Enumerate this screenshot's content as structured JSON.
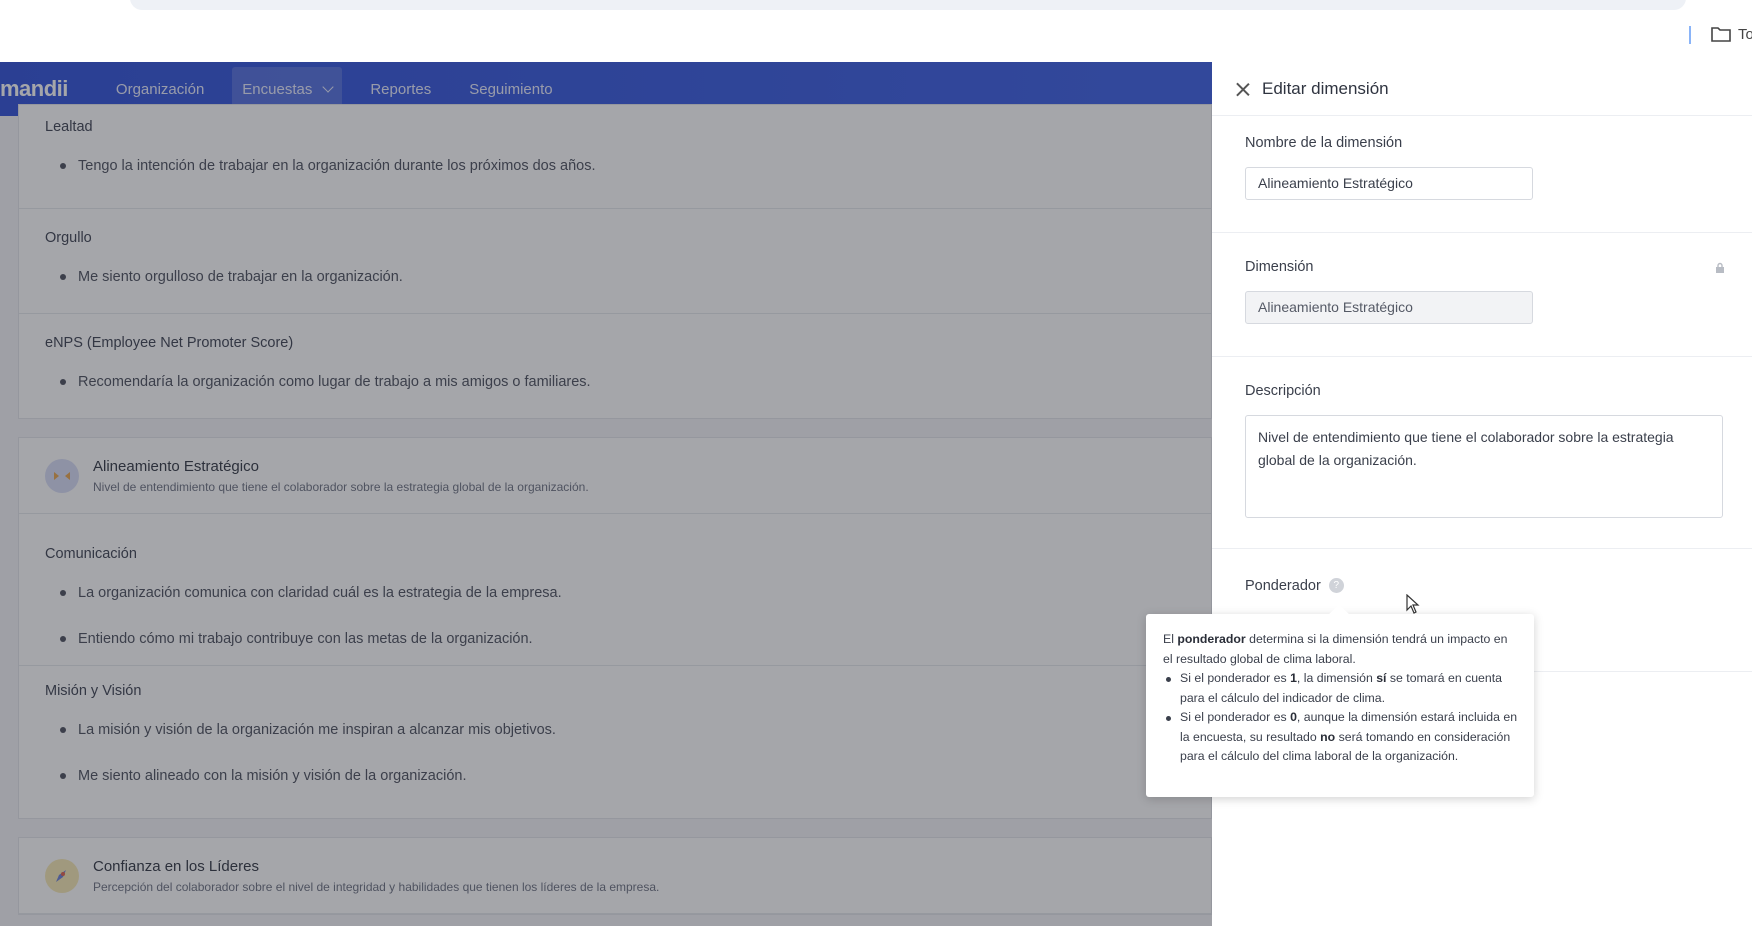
{
  "browser": {
    "bookmark_label": "To"
  },
  "header": {
    "logo": "mandii",
    "nav": [
      {
        "label": "Organización"
      },
      {
        "label": "Encuestas"
      },
      {
        "label": "Reportes"
      },
      {
        "label": "Seguimiento"
      }
    ]
  },
  "groups": [
    {
      "sections": [
        {
          "title": "Lealtad",
          "questions": [
            "Tengo la intención de trabajar en la organización durante los próximos dos años."
          ]
        },
        {
          "title": "Orgullo",
          "questions": [
            "Me siento orgulloso de trabajar en la organización."
          ]
        },
        {
          "title": "eNPS (Employee Net Promoter Score)",
          "questions": [
            "Recomendaría la organización como lugar de trabajo a mis amigos o familiares."
          ]
        }
      ]
    },
    {
      "dimension": {
        "name": "Alineamiento Estratégico",
        "description": "Nivel de entendimiento que tiene el colaborador sobre la estrategia global de la organización.",
        "icon": "target-icon"
      },
      "sections": [
        {
          "title": "Comunicación",
          "questions": [
            "La organización comunica con claridad cuál es la estrategia de la empresa.",
            "Entiendo cómo mi trabajo contribuye con las metas de la organización."
          ]
        },
        {
          "title": "Misión y Visión",
          "questions": [
            "La misión y visión de la organización me inspiran a alcanzar mis objetivos.",
            "Me siento alineado con la misión y visión de la organización."
          ]
        }
      ]
    },
    {
      "dimension": {
        "name": "Confianza en los Líderes",
        "description": "Percepción del colaborador sobre el nivel de integridad y habilidades que tienen los líderes de la empresa.",
        "icon": "rocket-icon"
      }
    }
  ],
  "panel": {
    "title": "Editar dimensión",
    "name_label": "Nombre de la dimensión",
    "name_value": "Alineamiento Estratégico",
    "dimension_label": "Dimensión",
    "dimension_value": "Alineamiento Estratégico",
    "description_label": "Descripción",
    "description_value": "Nivel de entendimiento que tiene el colaborador sobre la estrategia global de la organización.",
    "weight_label": "Ponderador",
    "weight_help": "?"
  },
  "tooltip": {
    "p1_a": "El ",
    "p1_b": "ponderador",
    "p1_c": " determina si la dimensión tendrá un impacto en el resultado global de clima laboral.",
    "li1_a": "Si el ponderador es ",
    "li1_b": "1",
    "li1_c": ", la dimensión ",
    "li1_d": "sí",
    "li1_e": " se tomará en cuenta para el cálculo del indicador de clima.",
    "li2_a": "Si el ponderador es ",
    "li2_b": "0",
    "li2_c": ", aunque la dimensión estará incluida en la encuesta, su resultado ",
    "li2_d": "no",
    "li2_e": " será tomando en consideración para el cálculo del clima laboral de la organización."
  },
  "colors": {
    "header": "#2d4fd8",
    "overlay": "rgba(40,44,52,0.42)"
  }
}
